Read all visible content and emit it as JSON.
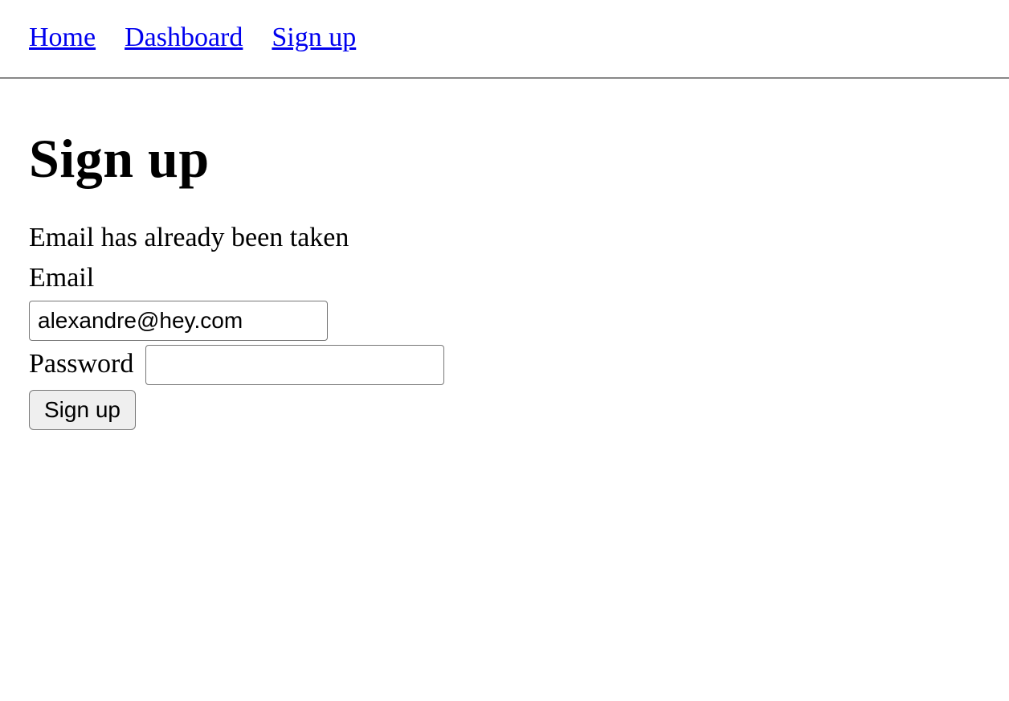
{
  "nav": {
    "items": [
      {
        "label": "Home"
      },
      {
        "label": "Dashboard"
      },
      {
        "label": "Sign up"
      }
    ]
  },
  "page": {
    "title": "Sign up"
  },
  "form": {
    "error": "Email has already been taken",
    "email_label": "Email",
    "email_value": "alexandre@hey.com",
    "password_label": "Password",
    "password_value": "",
    "submit_label": "Sign up"
  }
}
